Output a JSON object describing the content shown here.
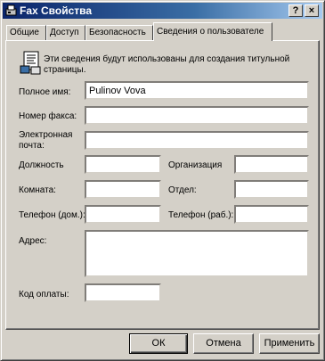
{
  "window": {
    "title": "Fax Свойства"
  },
  "titlebar": {
    "help_label": "?",
    "close_label": "×"
  },
  "tabs": [
    {
      "label": "Общие"
    },
    {
      "label": "Доступ"
    },
    {
      "label": "Безопасность"
    },
    {
      "label": "Сведения о пользователе",
      "active": true
    }
  ],
  "info": {
    "text_line1": "Эти сведения будут использованы для создания титульной",
    "text_line2": "страницы."
  },
  "form": {
    "full_name_label": "Полное имя:",
    "full_name_value": "Pulinov Vova",
    "fax_number_label": "Номер факса:",
    "fax_number_value": "",
    "email_label_line1": "Электронная",
    "email_label_line2": "почта:",
    "email_value": "",
    "position_label": "Должность",
    "position_value": "",
    "organization_label": "Организация",
    "organization_value": "",
    "room_label": "Комната:",
    "room_value": "",
    "department_label": "Отдел:",
    "department_value": "",
    "home_phone_label": "Телефон (дом.):",
    "home_phone_value": "",
    "work_phone_label": "Телефон (раб.):",
    "work_phone_value": "",
    "address_label": "Адрес:",
    "address_value": "",
    "billing_code_label": "Код оплаты:",
    "billing_code_value": ""
  },
  "buttons": {
    "ok": "ОК",
    "cancel": "Отмена",
    "apply": "Применить"
  },
  "icons": {
    "fax_title": "fax-icon",
    "info": "document-info-icon"
  },
  "colors": {
    "titlebar_start": "#0a246a",
    "titlebar_end": "#a6caf0",
    "face": "#d4d0c8"
  }
}
